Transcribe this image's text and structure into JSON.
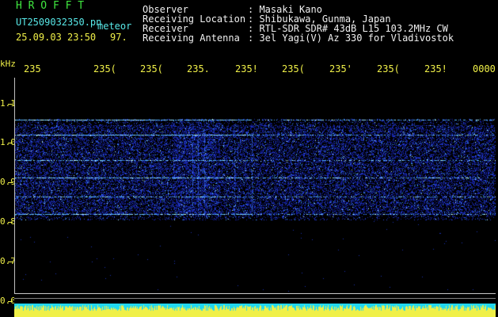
{
  "header": {
    "program": "H R O F F T",
    "filename": "UT2509032350.pn",
    "tag": "meteor",
    "datetime": "25.09.03 23:50",
    "count": "97.",
    "fields": [
      {
        "label": "Observer",
        "value": ": Masaki Kano"
      },
      {
        "label": "Receiving Location",
        "value": ": Shibukawa, Gunma, Japan"
      },
      {
        "label": "Receiver",
        "value": ": RTL-SDR SDR# 43dB L15 103.2MHz CW"
      },
      {
        "label": "Receiving Antenna",
        "value": ": 3el Yagi(V) Az 330 for Vladivostok"
      }
    ]
  },
  "plot": {
    "y_unit": "kHz",
    "y_ticks": [
      "1.1",
      "1.0",
      "0.9",
      "0.8",
      "0.7",
      "0.6"
    ],
    "x_ticks": [
      "235",
      "235(",
      "235(",
      "235.",
      "235!",
      "235(",
      "235'",
      "235(",
      "235!",
      "0000"
    ]
  },
  "colors": {
    "text_yellow": "#f0f048",
    "text_cyan": "#58e8e8",
    "text_green": "#40e840",
    "signal_blue": "#2030d0",
    "signal_peak": "#a0f0ff"
  }
}
